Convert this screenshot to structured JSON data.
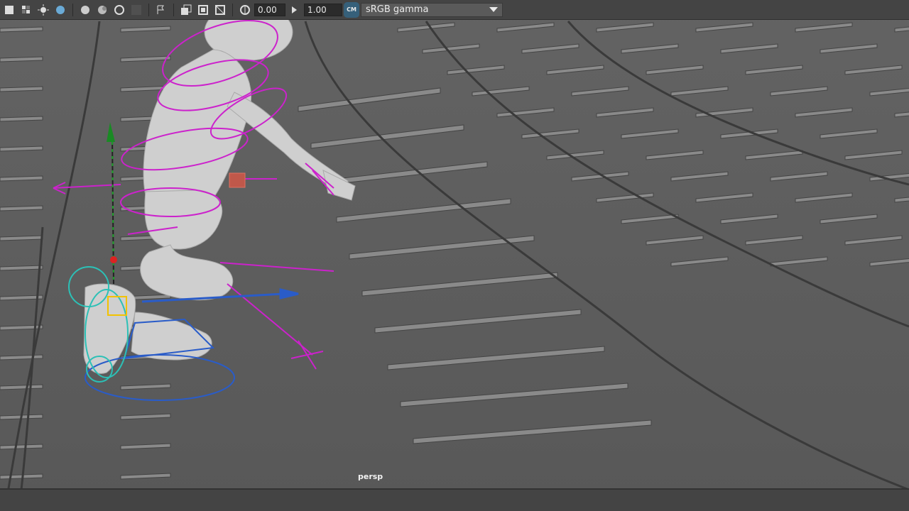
{
  "toolbar": {
    "icons": [
      "wireframe-shaded-icon",
      "textured-icon",
      "use-all-lights-icon",
      "shadows-icon",
      "ambient-occlusion-icon",
      "motion-blur-icon",
      "anti-aliasing-icon",
      "depth-of-field-icon",
      "isolate-select-icon",
      "xray-icon",
      "xray-active-components-icon",
      "xray-joints-icon",
      "exposure-icon",
      "gamma-icon"
    ],
    "exposure_value": "0.00",
    "gamma_value": "1.00",
    "color_space_label": "sRGB gamma"
  },
  "viewport": {
    "camera_label": "persp"
  },
  "colors": {
    "accent_magenta": "#cc22cc",
    "viewport_bg": "#5e5e5e",
    "toolbar_bg": "#444444",
    "selection_yellow": "#f2c200",
    "ik_blue": "#2a5cc8",
    "cyan_control": "#2cc0b6"
  }
}
